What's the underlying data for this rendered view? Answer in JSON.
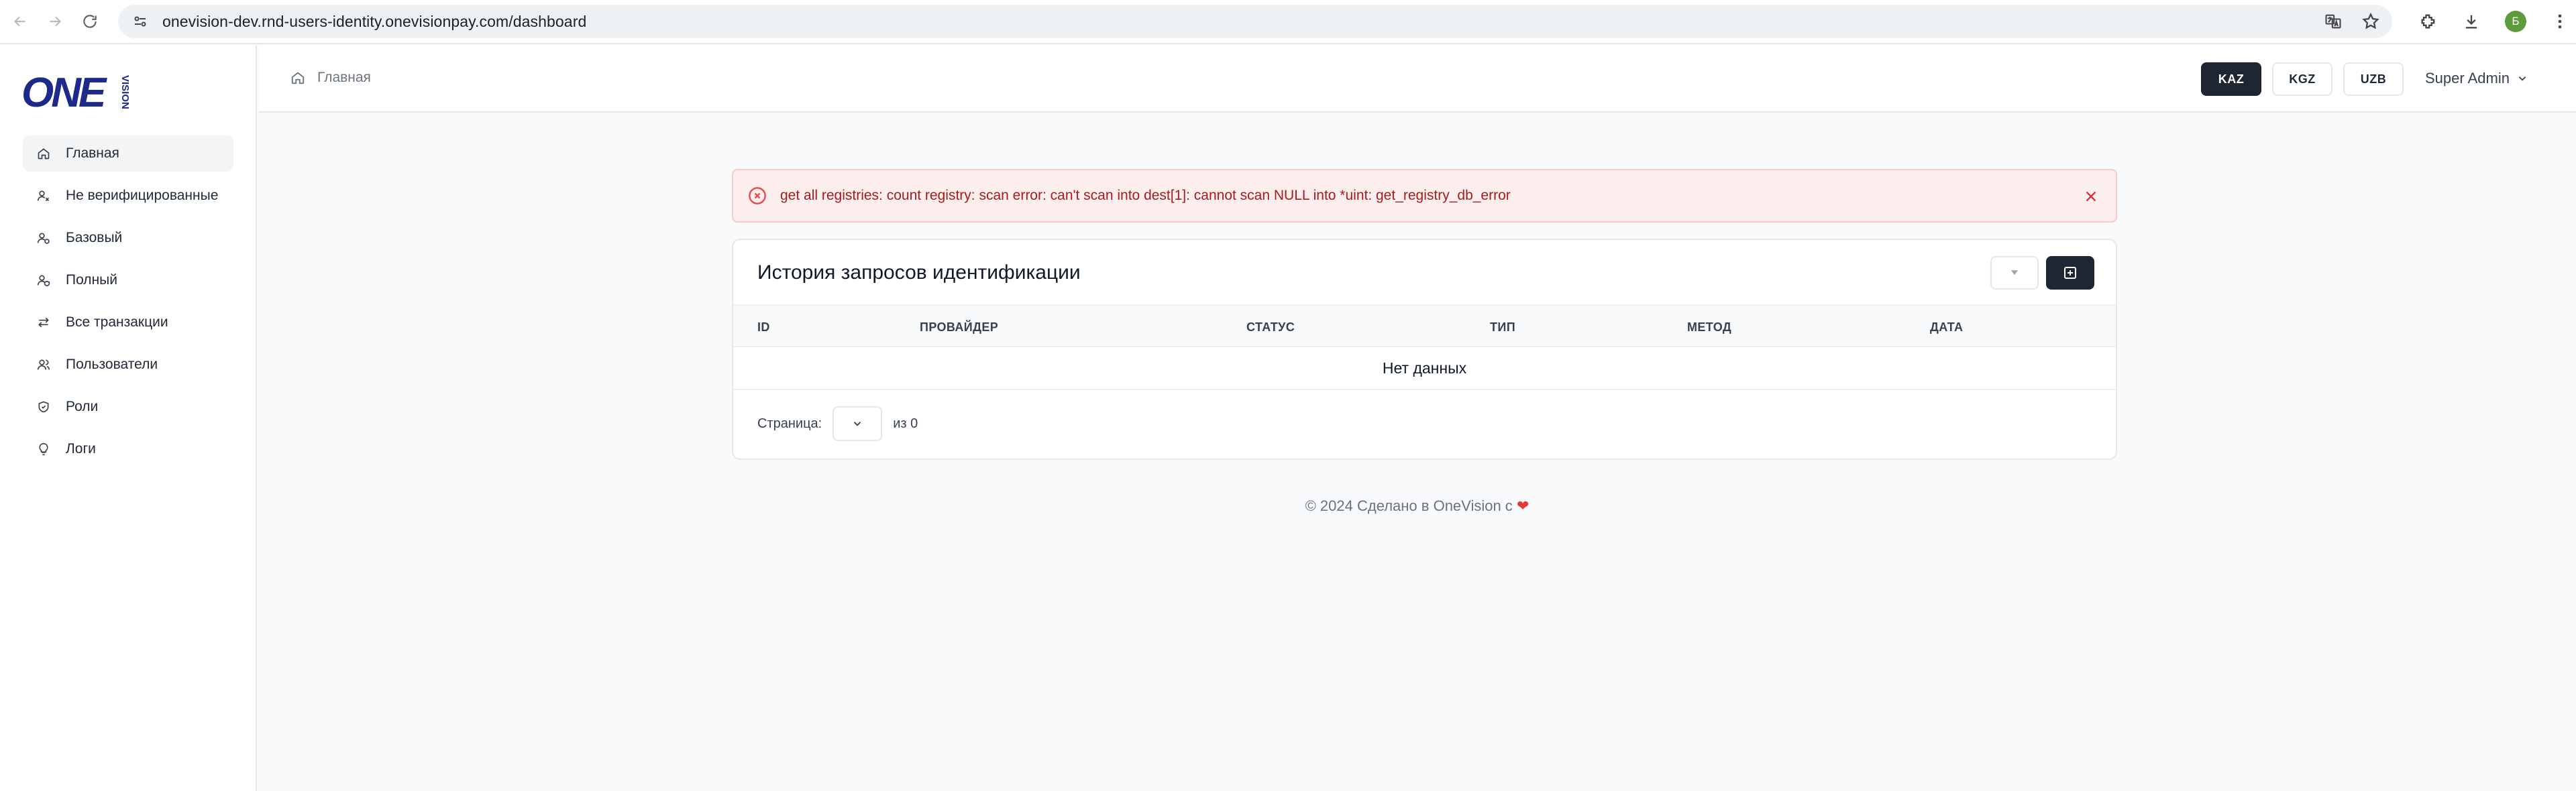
{
  "browser": {
    "url": "onevision-dev.rnd-users-identity.onevisionpay.com/dashboard",
    "profile_initial": "Б"
  },
  "sidebar": {
    "items": [
      {
        "label": "Главная",
        "icon": "home-icon",
        "active": true
      },
      {
        "label": "Не верифицированные",
        "icon": "user-x-icon",
        "active": false
      },
      {
        "label": "Базовый",
        "icon": "user-check-icon",
        "active": false
      },
      {
        "label": "Полный",
        "icon": "user-shield-icon",
        "active": false
      },
      {
        "label": "Все транзакции",
        "icon": "arrows-left-right-icon",
        "active": false
      },
      {
        "label": "Пользователи",
        "icon": "users-icon",
        "active": false
      },
      {
        "label": "Роли",
        "icon": "shield-icon",
        "active": false
      },
      {
        "label": "Логи",
        "icon": "lightbulb-icon",
        "active": false
      }
    ]
  },
  "header": {
    "breadcrumb": "Главная",
    "countries": [
      {
        "label": "KAZ",
        "active": true
      },
      {
        "label": "KGZ",
        "active": false
      },
      {
        "label": "UZB",
        "active": false
      }
    ],
    "user": "Super Admin"
  },
  "alert": {
    "message": "get all registries: count registry: scan error: can't scan into dest[1]: cannot scan NULL into *uint: get_registry_db_error"
  },
  "table": {
    "title": "История запросов идентификации",
    "columns": [
      "ID",
      "ПРОВАЙДЕР",
      "СТАТУС",
      "ТИП",
      "МЕТОД",
      "ДАТА"
    ],
    "empty_text": "Нет данных",
    "pagination": {
      "page_label": "Страница:",
      "total_label": "из 0"
    }
  },
  "footer": {
    "text": "© 2024 Сделано в OneVision с",
    "heart": "❤"
  },
  "colors": {
    "primary_dark": "#1e2533",
    "error_bg": "#fdeeee",
    "error_text": "#a61b1b",
    "brand_blue": "#1d2a8a"
  }
}
